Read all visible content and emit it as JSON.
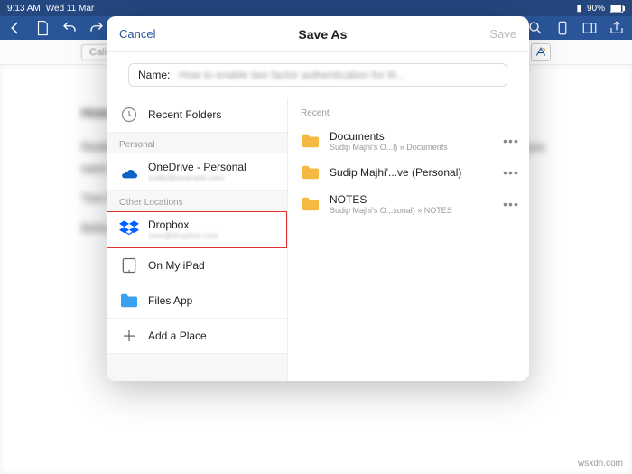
{
  "status": {
    "time": "9:13 AM",
    "date": "Wed 11 Mar",
    "battery_pct": "90%"
  },
  "subbar": {
    "font": "Calibri"
  },
  "dialog": {
    "cancel": "Cancel",
    "title": "Save As",
    "save": "Save",
    "name_label": "Name:",
    "name_value": "How to enable two factor authentication for th...",
    "recent_folders": "Recent Folders",
    "section_personal": "Personal",
    "onedrive_title": "OneDrive - Personal",
    "onedrive_sub": "sudip@example.com",
    "section_other": "Other Locations",
    "dropbox_title": "Dropbox",
    "dropbox_sub": "user@dropbox.com",
    "onipad_title": "On My iPad",
    "filesapp_title": "Files App",
    "addplace_title": "Add a Place",
    "right_recent": "Recent",
    "folders": [
      {
        "title": "Documents",
        "sub": "Sudip Majhi's O...l) » Documents"
      },
      {
        "title": "Sudip Majhi'...ve (Personal)",
        "sub": " "
      },
      {
        "title": "NOTES",
        "sub": "Sudip Majhi's O...sonal) » NOTES"
      }
    ]
  },
  "watermark": "wsxdn.com"
}
